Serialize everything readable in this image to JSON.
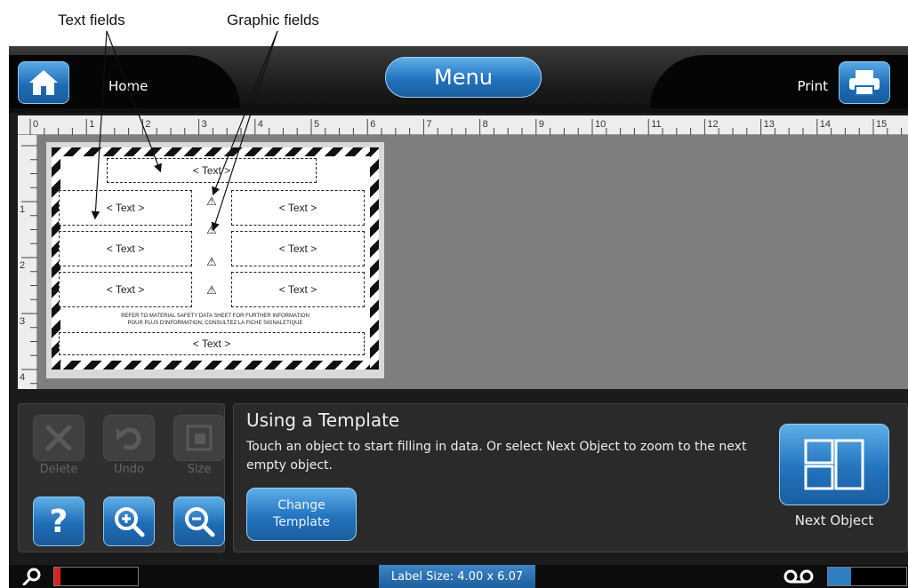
{
  "callouts": {
    "text_fields": "Text fields",
    "graphic_fields": "Graphic fields"
  },
  "topbar": {
    "home_label": "Home",
    "menu_label": "Menu",
    "print_label": "Print",
    "home_icon": "house-icon",
    "print_icon": "printer-icon"
  },
  "ruler": {
    "h_ticks": [
      "0",
      "1",
      "2",
      "3",
      "4",
      "5",
      "6",
      "7",
      "8",
      "9",
      "10",
      "11",
      "12",
      "13",
      "14",
      "15"
    ],
    "v_ticks": [
      "1",
      "2",
      "3",
      "4"
    ]
  },
  "label": {
    "fields": [
      "< Text >",
      "< Text >",
      "< Text >",
      "< Text >",
      "< Text >",
      "< Text >",
      "< Text >",
      "< Text >"
    ],
    "notice_line1": "REFER TO MATERIAL SAFETY DATA SHEET FOR FURTHER INFORMATION",
    "notice_line2": "POUR PLUS D'INFORMATION, CONSULTEZ LA FICHE SIGNALETIQUE",
    "graphic_glyph": "⚠"
  },
  "tools": {
    "delete": "Delete",
    "undo": "Undo",
    "size": "Size",
    "help_icon": "question-icon",
    "zoom_in_icon": "zoom-in-icon",
    "zoom_out_icon": "zoom-out-icon"
  },
  "info": {
    "title": "Using a Template",
    "body": "Touch an object to start filling in data. Or select Next Object to zoom to the next empty object.",
    "change_template_line1": "Change",
    "change_template_line2": "Template",
    "next_object": "Next Object"
  },
  "status": {
    "label_size": "Label Size: 4.00 x 6.07",
    "left_icon": "search-icon",
    "right_icon": "tape-icon",
    "left_bar_fill": 0.07,
    "right_bar_fill": 0.3
  },
  "colors": {
    "accent_blue": "#2273be",
    "frame_dark": "#1b1b1b",
    "canvas_gray": "#7e7e7e",
    "indicator_red": "#e02020"
  }
}
